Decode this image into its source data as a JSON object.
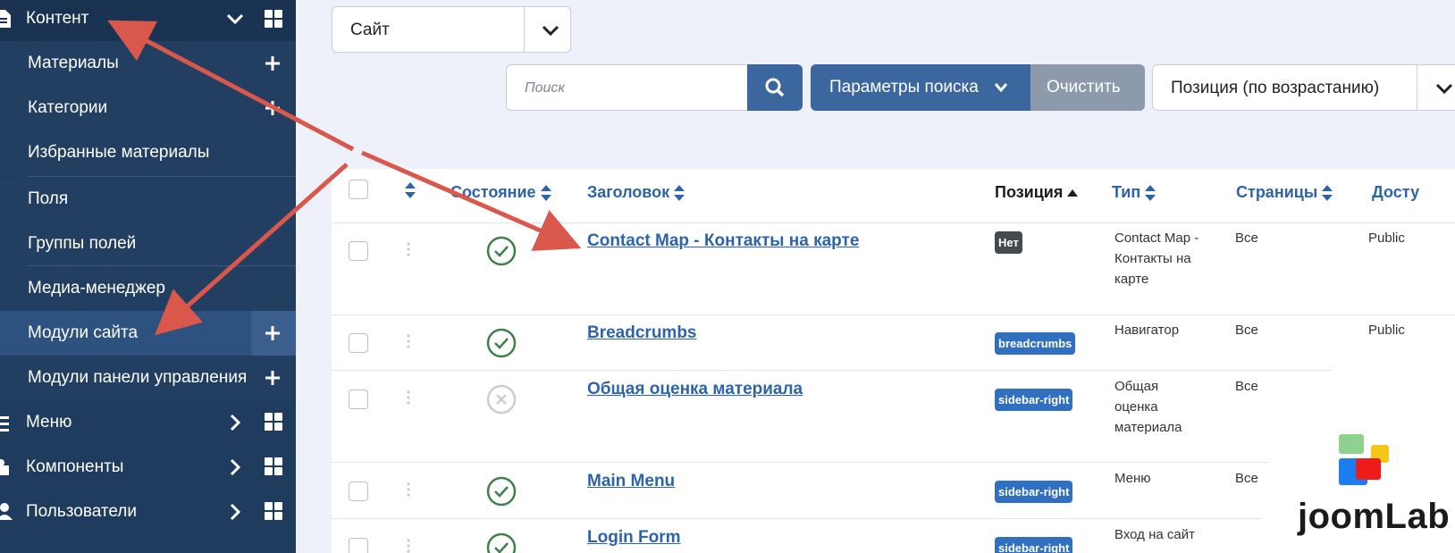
{
  "sidebar": {
    "content": {
      "label": "Контент"
    },
    "items": [
      {
        "label": "Материалы",
        "plus": true
      },
      {
        "label": "Категории",
        "plus": true
      },
      {
        "label": "Избранные материалы",
        "plus": false
      },
      {
        "label": "Поля",
        "plus": false
      },
      {
        "label": "Группы полей",
        "plus": false
      },
      {
        "label": "Медиа-менеджер",
        "plus": false
      },
      {
        "label": "Модули сайта",
        "plus": true,
        "active": true
      },
      {
        "label": "Модули панели управления",
        "plus": true
      }
    ],
    "menu": {
      "label": "Меню"
    },
    "components": {
      "label": "Компоненты"
    },
    "users": {
      "label": "Пользователи"
    }
  },
  "toolbar": {
    "site_select": "Сайт",
    "search_placeholder": "Поиск",
    "search_options": "Параметры поиска",
    "clear": "Очистить",
    "ordering": "Позиция (по возрастанию)"
  },
  "table": {
    "headers": {
      "status": "Состояние",
      "title": "Заголовок",
      "position": "Позиция",
      "type": "Тип",
      "pages": "Страницы",
      "access": "Досту"
    },
    "rows": [
      {
        "title": "Contact Map - Контакты на карте",
        "published": true,
        "position": "Нет",
        "type": "Contact Map - Контакты на карте",
        "pages": "Все",
        "access": "Public"
      },
      {
        "title": "Breadcrumbs",
        "published": true,
        "position": "breadcrumbs",
        "type": "Навигатор",
        "pages": "Все",
        "access": "Public"
      },
      {
        "title": "Общая оценка материала",
        "published": false,
        "position": "sidebar-right",
        "type": "Общая оценка материала",
        "pages": "Все",
        "access": ""
      },
      {
        "title": "Main Menu",
        "published": true,
        "position": "sidebar-right",
        "type": "Меню",
        "pages": "Все",
        "access": ""
      },
      {
        "title": "Login Form",
        "published": true,
        "position": "sidebar-right",
        "type": "Вход на сайт",
        "pages": "",
        "access": ""
      }
    ]
  },
  "logo": {
    "text": "joomLab"
  },
  "colors": {
    "sidebar": "#1f3c5e",
    "accent": "#3b679e",
    "annotation": "#d9574b",
    "published": "#3f7f4a"
  }
}
